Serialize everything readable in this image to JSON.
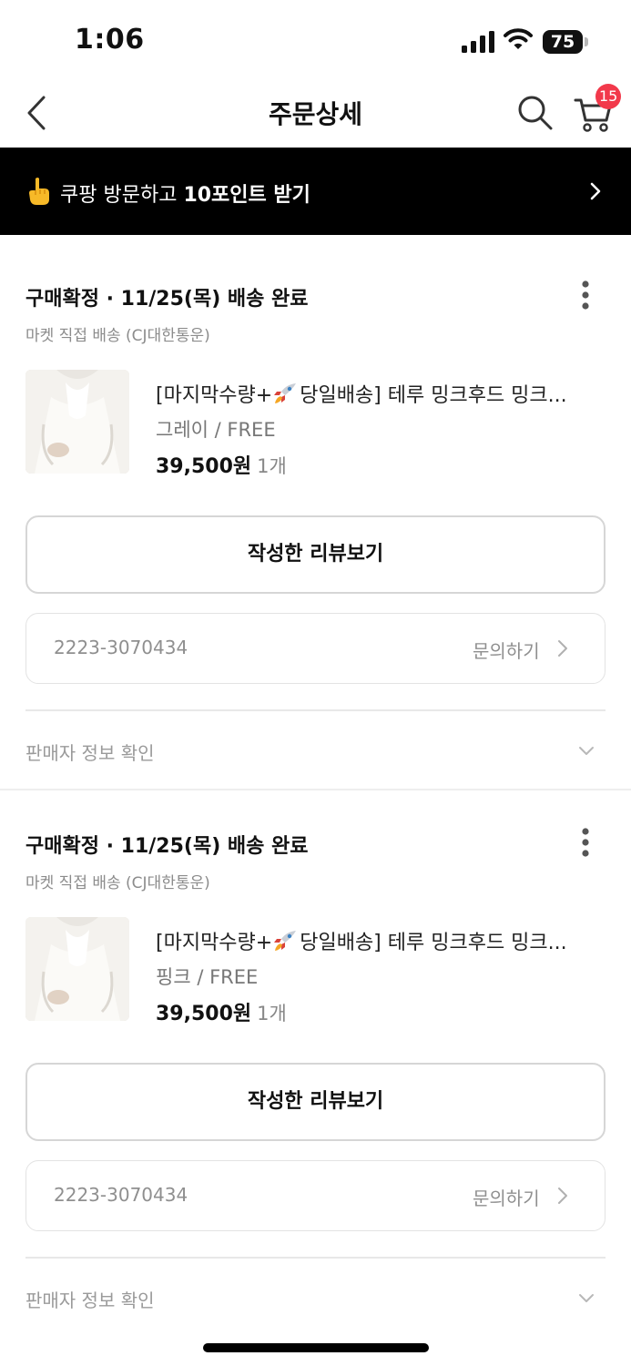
{
  "status_bar": {
    "time": "1:06",
    "battery": "75"
  },
  "header": {
    "title": "주문상세",
    "back_icon": "chevron-left-icon",
    "search_icon": "search-icon",
    "cart_icon": "cart-icon",
    "cart_count": "15",
    "badge_color": "#f2394b"
  },
  "banner": {
    "icon": "pointing-hand-icon",
    "text_prefix": "쿠팡 방문하고 ",
    "text_strong": "10포인트 받기",
    "arrow_icon": "chevron-right-icon"
  },
  "orders": [
    {
      "status": "구매확정 · 11/25(목) 배송 완료",
      "shipping": "마켓 직접 배송 (CJ대한통운)",
      "product_name_before": "[마지막수량+",
      "product_name_after": "당일배송] 테루 밍크후드 밍크...",
      "rocket_icon": "rocket-icon",
      "option": "그레이 / FREE",
      "price": "39,500원",
      "quantity": "1개",
      "review_button": "작성한 리뷰보기",
      "order_number": "2223-3070434",
      "inquiry": "문의하기",
      "seller_info": "판매자 정보 확인"
    },
    {
      "status": "구매확정 · 11/25(목) 배송 완료",
      "shipping": "마켓 직접 배송 (CJ대한통운)",
      "product_name_before": "[마지막수량+",
      "product_name_after": "당일배송] 테루 밍크후드 밍크...",
      "rocket_icon": "rocket-icon",
      "option": "핑크 / FREE",
      "price": "39,500원",
      "quantity": "1개",
      "review_button": "작성한 리뷰보기",
      "order_number": "2223-3070434",
      "inquiry": "문의하기",
      "seller_info": "판매자 정보 확인"
    }
  ]
}
